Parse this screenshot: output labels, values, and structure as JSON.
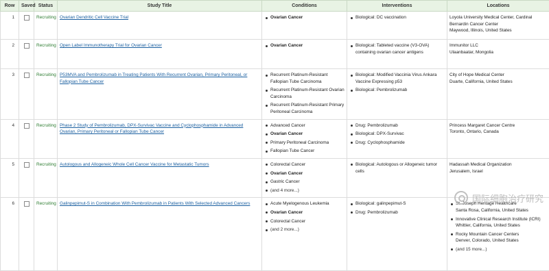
{
  "headers": {
    "row": "Row",
    "saved": "Saved",
    "status": "Status",
    "title": "Study Title",
    "conditions": "Conditions",
    "interventions": "Interventions",
    "locations": "Locations"
  },
  "rows": [
    {
      "num": "1",
      "status": "Recruiting",
      "title": "Ovarian Dendritic Cell Vaccine Trial",
      "conditions": [
        "Ovarian Cancer"
      ],
      "interventions": [
        "Biological: DC vaccination"
      ],
      "locations": [
        "Loyola University Medical Center, Cardinal Bernardin Cancer Center",
        "Maywood, Illinois, United States"
      ]
    },
    {
      "num": "2",
      "status": "Recruiting",
      "title": "Open Label Immunotherapy Trial for Ovarian Cancer",
      "conditions": [
        "Ovarian Cancer"
      ],
      "interventions": [
        "Biological: Tableted vaccine (V3-OVA) containing ovarian cancer antigens"
      ],
      "locations": [
        "Immunitor LLC",
        "Ulaanbaatar, Mongolia"
      ]
    },
    {
      "num": "3",
      "status": "Recruiting",
      "title": "P53MVA and Pembrolizumab in Treating Patients With Recurrent Ovarian, Primary Peritoneal, or Fallopian Tube Cancer",
      "conditions": [
        "Recurrent Platinum-Resistant Fallopian Tube Carcinoma",
        "Recurrent Platinum-Resistant Ovarian Carcinoma",
        "Recurrent Platinum-Resistant Primary Peritoneal Carcinoma"
      ],
      "interventions": [
        "Biological: Modified Vaccinia Virus Ankara Vaccine Expressing p53",
        "Biological: Pembrolizumab"
      ],
      "locations": [
        "City of Hope Medical Center",
        "Duarte, California, United States"
      ]
    },
    {
      "num": "4",
      "status": "Recruiting",
      "title": "Phase 2 Study of Pembrolizumab, DPX-Survivac Vaccine and Cyclophosphamide in Advanced Ovarian, Primary Peritoneal or Fallopian Tube Cancer",
      "conditions": [
        "Advanced Cancer",
        "Ovarian Cancer",
        "Primary Peritoneal Carcinoma",
        "Fallopian Tube Cancer"
      ],
      "interventions": [
        "Drug: Pembrolizumab",
        "Biological: DPX-Survivac",
        "Drug: Cyclophosphamide"
      ],
      "locations": [
        "Princess Margaret Cancer Centre",
        "Toronto, Ontario, Canada"
      ]
    },
    {
      "num": "5",
      "status": "Recruiting",
      "title": "Autologous and Allogeneic Whole Cell Cancer Vaccine for Metastatic Tumors",
      "conditions": [
        "Colorectal Cancer",
        "Ovarian Cancer",
        "Gastric Cancer",
        "(and 4 more...)"
      ],
      "interventions": [
        "Biological: Autologous or Allogeneic tumor cells"
      ],
      "locations": [
        "Hadassah Medical Organization",
        "Jerusalem, Israel"
      ]
    },
    {
      "num": "6",
      "status": "Recruiting",
      "title": "Galinpepimut-S in Combination With Pembrolizumab in Patients With Selected Advanced Cancers",
      "conditions": [
        "Acute Myelogenous Leukemia",
        "Ovarian Cancer",
        "Colorectal Cancer",
        "(and 2 more...)"
      ],
      "interventions": [
        "Biological: galinpepimut-S",
        "Drug: Pembrolizumab"
      ],
      "locations": [
        "St. Joseph Heritage Healthcare",
        "Santa Rosa, California, United States",
        "Innovative Clinical Research Institute (ICRI)",
        "Whittier, California, United States",
        "Rocky Mountain Cancer Centers",
        "Denver, Colorado, United States",
        "(and 15 more...)"
      ]
    }
  ],
  "watermark": "国际细胞治疗研究"
}
